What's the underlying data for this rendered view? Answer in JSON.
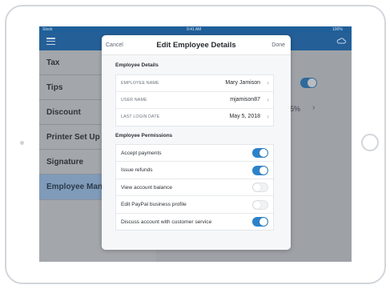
{
  "status": {
    "carrier": "Stock",
    "time": "9:41 AM",
    "battery": "100%"
  },
  "sidebar": {
    "items": [
      {
        "label": "Tax"
      },
      {
        "label": "Tips"
      },
      {
        "label": "Discount"
      },
      {
        "label": "Printer Set Up"
      },
      {
        "label": "Signature"
      },
      {
        "label": "Employee Management"
      }
    ]
  },
  "background": {
    "percent_text": "5%",
    "tips_toggle_on": true
  },
  "modal": {
    "cancel_label": "Cancel",
    "title": "Edit Employee Details",
    "done_label": "Done",
    "details_title": "Employee Details",
    "details": [
      {
        "label": "EMPLOYEE NAME",
        "value": "Mary Jamison"
      },
      {
        "label": "USER NAME",
        "value": "mjamison87"
      },
      {
        "label": "LAST LOGIN DATE",
        "value": "May 5, 2018"
      }
    ],
    "permissions_title": "Employee Permissions",
    "permissions": [
      {
        "label": "Accept payments",
        "enabled": true
      },
      {
        "label": "Issue refunds",
        "enabled": true
      },
      {
        "label": "View account balance",
        "enabled": false
      },
      {
        "label": "Edit PayPal business profile",
        "enabled": false
      },
      {
        "label": "Discuss account with customer service",
        "enabled": true
      }
    ]
  },
  "colors": {
    "navbar": "#245f98",
    "toggle_on": "#2c82c9",
    "sidebar_active": "#7f9bb9"
  }
}
